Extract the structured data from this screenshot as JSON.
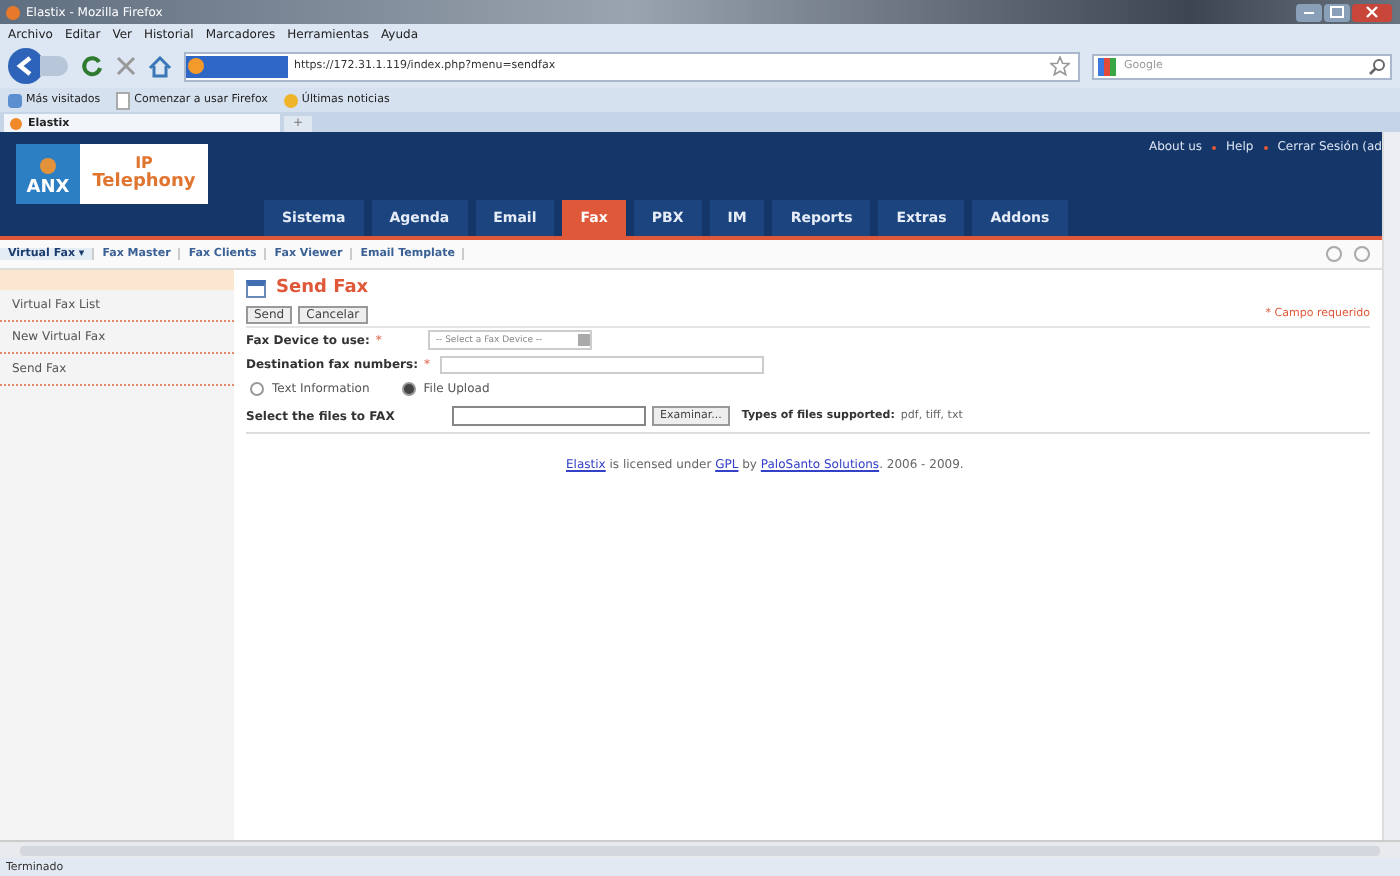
{
  "window": {
    "title": "Elastix - Mozilla Firefox"
  },
  "menu_bar": [
    "Archivo",
    "Editar",
    "Ver",
    "Historial",
    "Marcadores",
    "Herramientas",
    "Ayuda"
  ],
  "address_bar": {
    "url": "https://172.31.1.119/index.php?menu=sendfax"
  },
  "search": {
    "placeholder": "Google"
  },
  "bookmarks": [
    {
      "label": "Más visitados",
      "kind": "star"
    },
    {
      "label": "Comenzar a usar Firefox",
      "kind": "page"
    },
    {
      "label": "Últimas noticias",
      "kind": "feed"
    }
  ],
  "browser_tab": {
    "title": "Elastix",
    "new_tab": "+"
  },
  "logo": {
    "brand": "ANX",
    "product_top": "IP",
    "product": "Telephony"
  },
  "top_links": [
    "About us",
    "Help",
    "Cerrar Sesión (ad"
  ],
  "main_tabs": [
    {
      "label": "Sistema",
      "selected": false
    },
    {
      "label": "Agenda",
      "selected": false
    },
    {
      "label": "Email",
      "selected": false
    },
    {
      "label": "Fax",
      "selected": true
    },
    {
      "label": "PBX",
      "selected": false
    },
    {
      "label": "IM",
      "selected": false
    },
    {
      "label": "Reports",
      "selected": false
    },
    {
      "label": "Extras",
      "selected": false
    },
    {
      "label": "Addons",
      "selected": false
    }
  ],
  "sub_tabs": [
    {
      "label": "Virtual Fax ▾",
      "selected": true
    },
    {
      "label": "Fax Master",
      "selected": false
    },
    {
      "label": "Fax Clients",
      "selected": false
    },
    {
      "label": "Fax Viewer",
      "selected": false
    },
    {
      "label": "Email Template",
      "selected": false
    }
  ],
  "sidebar": {
    "items": [
      "Virtual Fax List",
      "New Virtual Fax",
      "Send Fax"
    ]
  },
  "form": {
    "title": "Send Fax",
    "buttons": [
      "Send",
      "Cancelar"
    ],
    "required_note": "* Campo requerido",
    "device": {
      "label": "Fax Device to use:",
      "required": "*",
      "placeholder": "-- Select a Fax Device --"
    },
    "destination": {
      "label": "Destination fax numbers:",
      "required": "*"
    },
    "modes": [
      {
        "label": "Text Information",
        "selected": false
      },
      {
        "label": "File Upload",
        "selected": true
      }
    ],
    "file": {
      "label": "Select the files to FAX",
      "browse": "Examinar...",
      "types": "Types of files supported:",
      "types_value": "pdf, tiff, txt"
    }
  },
  "footer": [
    {
      "text": "Elastix",
      "kind": "link"
    },
    {
      "text": " is licensed under ",
      "kind": "text"
    },
    {
      "text": "GPL",
      "kind": "link"
    },
    {
      "text": " by ",
      "kind": "text"
    },
    {
      "text": "PaloSanto Solutions",
      "kind": "link"
    },
    {
      "text": ". 2006 - 2009.",
      "kind": "text"
    }
  ],
  "status_bar": "Terminado"
}
